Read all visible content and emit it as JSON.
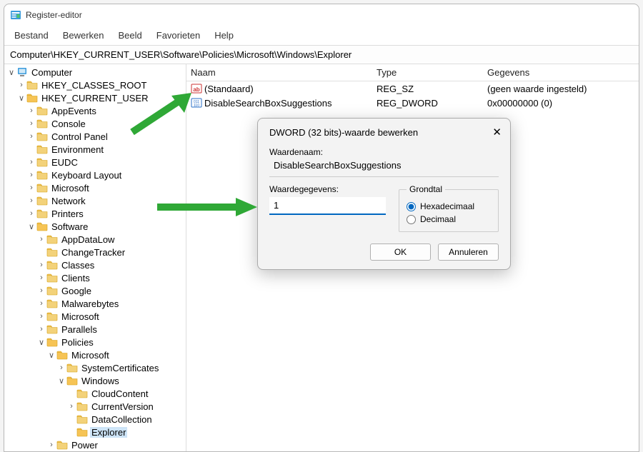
{
  "window": {
    "title": "Register-editor"
  },
  "menu": {
    "items": [
      "Bestand",
      "Bewerken",
      "Beeld",
      "Favorieten",
      "Help"
    ]
  },
  "address": "Computer\\HKEY_CURRENT_USER\\Software\\Policies\\Microsoft\\Windows\\Explorer",
  "tree": {
    "root": "Computer",
    "hkcr": "HKEY_CLASSES_ROOT",
    "hkcu": "HKEY_CURRENT_USER",
    "hkcu_children": [
      "AppEvents",
      "Console",
      "Control Panel",
      "Environment",
      "EUDC",
      "Keyboard Layout",
      "Microsoft",
      "Network",
      "Printers",
      "Software"
    ],
    "software_children": [
      "AppDataLow",
      "ChangeTracker",
      "Classes",
      "Clients",
      "Google",
      "Malwarebytes",
      "Microsoft",
      "Parallels",
      "Policies"
    ],
    "policies_children": [
      "Microsoft"
    ],
    "microsoft_children": [
      "SystemCertificates",
      "Windows"
    ],
    "windows_children": [
      "CloudContent",
      "CurrentVersion",
      "DataCollection",
      "Explorer"
    ],
    "after_policies": [
      "Power"
    ],
    "selected": "Explorer"
  },
  "list": {
    "headers": {
      "name": "Naam",
      "type": "Type",
      "data": "Gegevens"
    },
    "rows": [
      {
        "icon": "string",
        "name": "(Standaard)",
        "type": "REG_SZ",
        "data": "(geen waarde ingesteld)"
      },
      {
        "icon": "dword",
        "name": "DisableSearchBoxSuggestions",
        "type": "REG_DWORD",
        "data": "0x00000000 (0)"
      }
    ]
  },
  "dialog": {
    "title": "DWORD (32 bits)-waarde bewerken",
    "value_name_label": "Waardenaam:",
    "value_name": "DisableSearchBoxSuggestions",
    "value_data_label": "Waardegegevens:",
    "value_data": "1",
    "base_label": "Grondtal",
    "hex": "Hexadecimaal",
    "dec": "Decimaal",
    "ok": "OK",
    "cancel": "Annuleren"
  }
}
